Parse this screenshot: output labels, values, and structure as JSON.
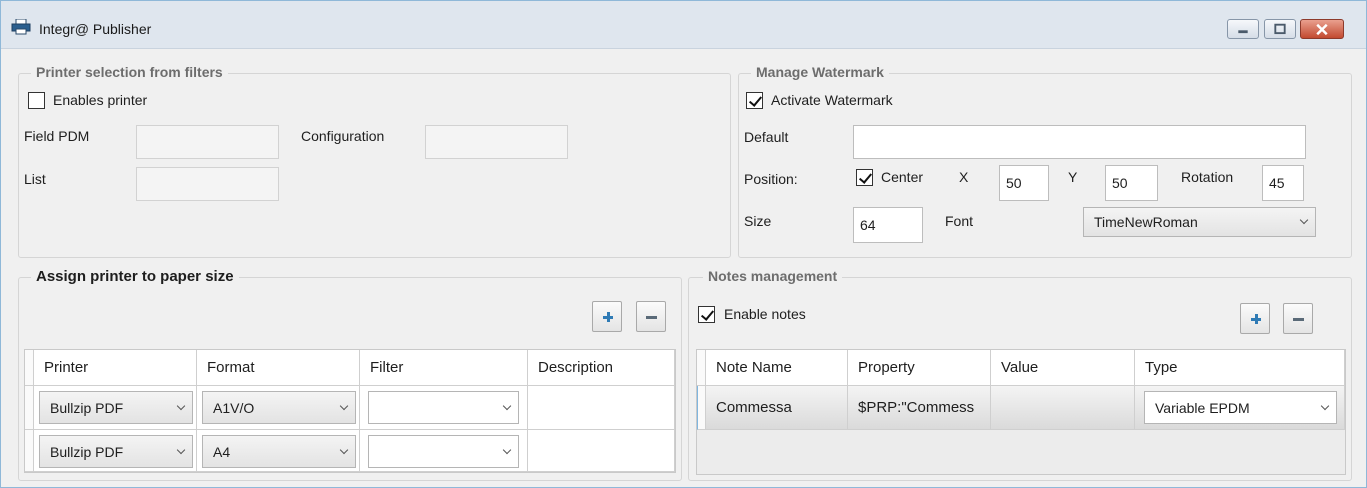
{
  "window": {
    "title": "Integr@ Publisher"
  },
  "printer_selection": {
    "legend": "Printer selection from filters",
    "enables_printer_label": "Enables printer",
    "enables_printer_checked": false,
    "field_pdm_label": "Field PDM",
    "field_pdm_value": "",
    "configuration_label": "Configuration",
    "configuration_value": "",
    "list_label": "List",
    "list_value": ""
  },
  "watermark": {
    "legend": "Manage Watermark",
    "activate_label": "Activate Watermark",
    "activate_checked": true,
    "default_label": "Default",
    "default_value": "",
    "position_label": "Position:",
    "center_label": "Center",
    "center_checked": true,
    "x_label": "X",
    "x_value": "50",
    "y_label": "Y",
    "y_value": "50",
    "rotation_label": "Rotation",
    "rotation_value": "45",
    "size_label": "Size",
    "size_value": "64",
    "font_label": "Font",
    "font_value": "TimeNewRoman"
  },
  "paper": {
    "legend": "Assign printer to paper size",
    "columns": [
      "Printer",
      "Format",
      "Filter",
      "Description"
    ],
    "rows": [
      {
        "printer": "Bullzip PDF",
        "format": "A1V/O",
        "filter": "",
        "description": ""
      },
      {
        "printer": "Bullzip PDF",
        "format": "A4",
        "filter": "",
        "description": ""
      }
    ]
  },
  "notes": {
    "legend": "Notes management",
    "enable_label": "Enable notes",
    "enable_checked": true,
    "columns": [
      "Note Name",
      "Property",
      "Value",
      "Type"
    ],
    "rows": [
      {
        "name": "Commessa",
        "property": "$PRP:\"Commess",
        "value": "",
        "type": "Variable EPDM"
      }
    ]
  },
  "icons": [
    "printer-icon",
    "minimize-icon",
    "maximize-icon",
    "close-icon",
    "plus-icon",
    "minus-icon",
    "chevron-down-icon",
    "checkmark-icon"
  ],
  "colors": {
    "accent_blue": "#2f7bb5",
    "close_red": "#c24a30",
    "frame": "#8fb8d8"
  }
}
